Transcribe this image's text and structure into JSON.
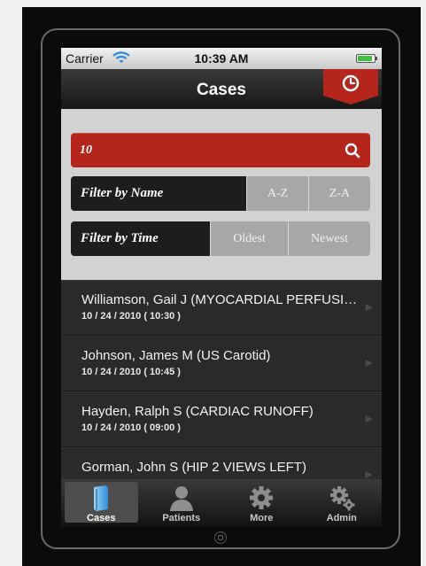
{
  "status_bar": {
    "carrier": "Carrier",
    "time": "10:39 AM",
    "battery_level": 0.9
  },
  "nav": {
    "title": "Cases"
  },
  "search": {
    "value": "10"
  },
  "filter_name": {
    "label": "Filter by Name",
    "options": [
      "A-Z",
      "Z-A"
    ]
  },
  "filter_time": {
    "label": "Filter by Time",
    "options": [
      "Oldest",
      "Newest"
    ]
  },
  "cases": [
    {
      "name": "Williamson, Gail J (MYOCARDIAL PERFUSION)",
      "date": "10 / 24 / 2010 ( 10:30 )"
    },
    {
      "name": "Johnson, James M (US Carotid)",
      "date": "10 / 24 / 2010 ( 10:45 )"
    },
    {
      "name": "Hayden, Ralph S (CARDIAC RUNOFF)",
      "date": "10 / 24 / 2010 ( 09:00 )"
    },
    {
      "name": "Gorman, John S (HIP 2 VIEWS LEFT)",
      "date": ""
    }
  ],
  "tabs": [
    {
      "label": "Cases",
      "icon": "book-icon"
    },
    {
      "label": "Patients",
      "icon": "person-icon"
    },
    {
      "label": "More",
      "icon": "gear-icon"
    },
    {
      "label": "Admin",
      "icon": "gears-icon"
    }
  ],
  "colors": {
    "accent": "#b4261c",
    "filter_dark": "#1d1d1d",
    "filter_option": "#a7a7a7"
  }
}
